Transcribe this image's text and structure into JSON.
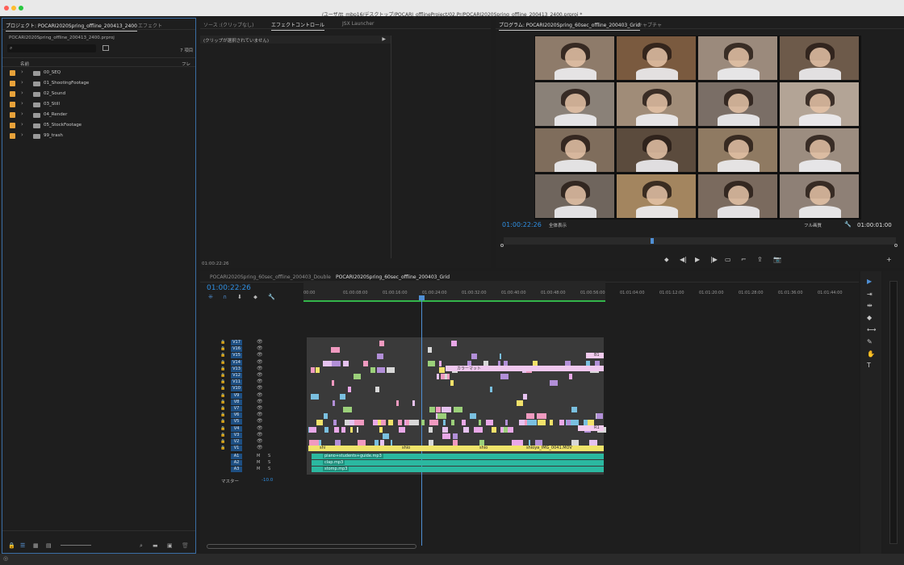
{
  "window": {
    "title": "/ユーザ/tt_mbp16/デスクトップ/POCARI_offlineProject/02.Pr/POCARI2020Spring_offline_200413_2400.prproj *"
  },
  "project_panel": {
    "tabs": [
      "プロジェクト: POCARI2020Spring_offline_200413_2400",
      "エフェクト"
    ],
    "file": "POCARI2020Spring_offline_200413_2400.prproj",
    "item_count": "7 項目",
    "col_name": "名前",
    "col_frame": "フレ",
    "bins": [
      {
        "label": "00_SEQ"
      },
      {
        "label": "01_ShootingFootage"
      },
      {
        "label": "02_Sound"
      },
      {
        "label": "03_Still"
      },
      {
        "label": "04_Render"
      },
      {
        "label": "05_StockFootage"
      },
      {
        "label": "99_trash"
      }
    ],
    "bin_color": "#e8a23a"
  },
  "source_panel": {
    "tabs": [
      "ソース :(クリップなし)",
      "エフェクトコントロール",
      "JSX Launcher"
    ],
    "empty_msg": "(クリップが選択されていません)",
    "timecode": "01:00:22:26"
  },
  "program_panel": {
    "tabs": [
      "プログラム: POCARI2020Spring_60sec_offline_200403_Grid",
      "キャプチャ"
    ],
    "timecode": "01:00:22:26",
    "zoom": "全体表示",
    "quality": "フル画質",
    "duration": "01:00:01:00",
    "accent": "#2f8ee0"
  },
  "timeline": {
    "tabs": [
      "POCARI2020Spring_60sec_offline_200403_Double",
      "POCARI2020Spring_60sec_offline_200403_Grid"
    ],
    "timecode": "01:00:22:26",
    "ruler": [
      "00:00",
      "01:00:08:00",
      "01:00:16:00",
      "01:00:24:00",
      "01:00:32:00",
      "01:00:40:00",
      "01:00:48:00",
      "01:00:56:00",
      "01:01:04:00",
      "01:01:12:00",
      "01:01:20:00",
      "01:01:28:00",
      "01:01:36:00",
      "01:01:44:00"
    ],
    "video_tracks": [
      "V17",
      "V16",
      "V15",
      "V14",
      "V13",
      "V12",
      "V11",
      "V10",
      "V9",
      "V8",
      "V7",
      "V6",
      "V5",
      "V4",
      "V3",
      "V2",
      "V1"
    ],
    "audio_tracks": [
      "A1",
      "A2",
      "A3"
    ],
    "master_label": "マスター",
    "master_level": "-10.0",
    "clip_labels": {
      "color_matte": "カラーマット",
      "v1_clips": [
        "shi",
        "shio",
        "shio",
        "shioya_IMG_0041.MOV"
      ],
      "a1": "piano+students+guide.mp3",
      "a2": "clap.mp3",
      "a3": "stomp.mp3",
      "b1": "B1",
      "r1": "R1"
    },
    "audio_color": "#2bb8a0",
    "playhead_color": "#4f8fd4"
  }
}
